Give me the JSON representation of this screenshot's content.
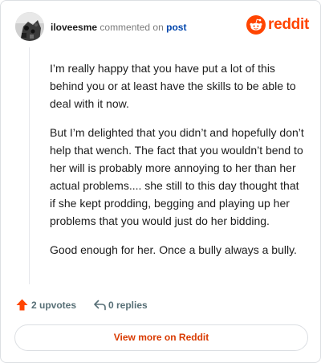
{
  "header": {
    "username": "iloveesme",
    "commented_text": "commented on",
    "post_link": "post",
    "logo_text": "reddit"
  },
  "comment": {
    "paragraphs": [
      "I’m really happy that you have put a lot of this behind you or at least have the skills to be able to deal with it now.",
      "But I’m delighted that you didn’t and hopefully don’t help that wench. The fact that you wouldn’t bend to her will is probably more annoying to her than her actual problems.... she still to this day thought that if she kept prodding, begging and playing up her problems that you would just do her bidding.",
      "Good enough for her. Once a bully always a bully."
    ]
  },
  "actions": {
    "upvotes_label": "2 upvotes",
    "replies_label": "0 replies"
  },
  "footer": {
    "view_more_label": "View more on Reddit"
  },
  "icons": {
    "avatar": "avatar-icon",
    "logo": "reddit-logo-icon",
    "upvote": "upvote-arrow-icon",
    "reply": "reply-arrow-icon"
  },
  "colors": {
    "brand": "#ff4500",
    "link": "#0045ac",
    "muted": "#576f76",
    "view_more": "#d93a00"
  }
}
